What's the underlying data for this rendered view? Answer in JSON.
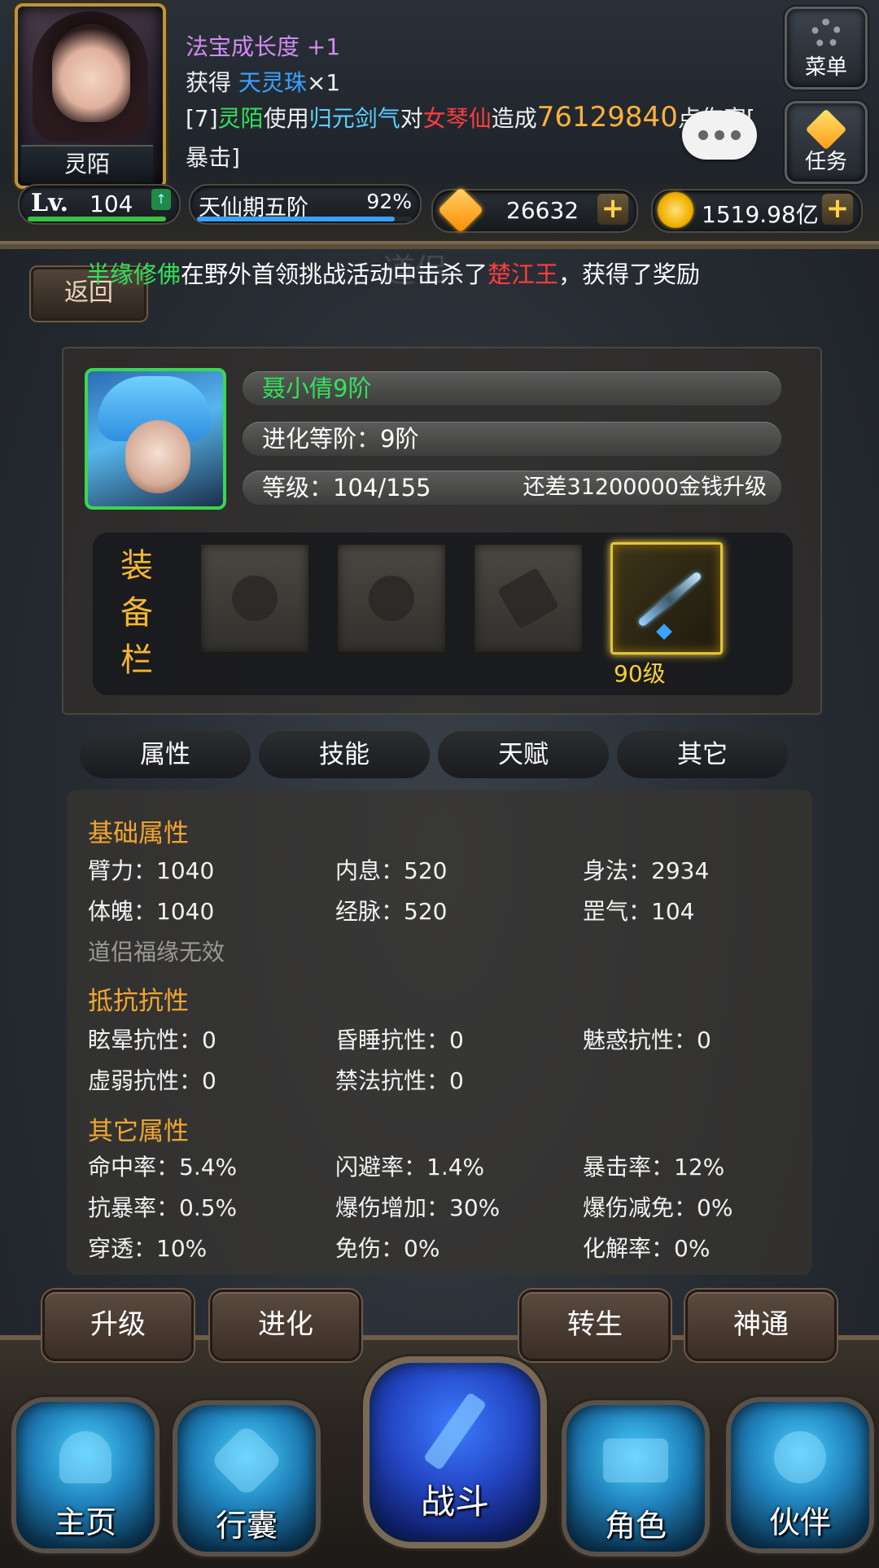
{
  "player": {
    "avatar_name": "灵陌",
    "level_prefix": "Lv.",
    "level": "104",
    "realm": "天仙期五阶",
    "realm_progress": "92%",
    "realm_progress_value": 0.92,
    "diamonds": "26632",
    "gold": "1519.98亿"
  },
  "messages": {
    "line1_label": "法宝成长度",
    "line1_value": "+1",
    "line2_prefix": "获得",
    "line2_item": "天灵珠",
    "line2_count": "×1",
    "line3_tag": "[7]",
    "line3_actor": "灵陌",
    "line3_use": "使用",
    "line3_skill": "归元剑气",
    "line3_to": "对",
    "line3_target": "女琴仙",
    "line3_cause": "造成",
    "line3_damage": "76129840",
    "line3_tail": "点伤害[",
    "line4": "暴击]"
  },
  "side_buttons": {
    "menu": "菜单",
    "task": "任务"
  },
  "broadcast": {
    "player": "半缘修佛",
    "text1": "在野外首领挑战活动中击杀了",
    "boss": "楚江王",
    "text2": "，获得了奖励"
  },
  "nav_top": {
    "back": "返回",
    "faded_title": "道侣"
  },
  "partner": {
    "name": "聂小倩9阶",
    "evolve": "进化等阶：9阶",
    "level": "等级：104/155",
    "upgrade_hint": "还差31200000金钱升级"
  },
  "equipment": {
    "label_chars": [
      "装",
      "备",
      "栏"
    ],
    "weapon_level": "90级"
  },
  "tabs": [
    "属性",
    "技能",
    "天赋",
    "其它"
  ],
  "attributes": {
    "basic_title": "基础属性",
    "basic": [
      "臂力：1040",
      "内息：520",
      "身法：2934",
      "体魄：1040",
      "经脉：520",
      "罡气：104"
    ],
    "basic_note": "道侣福缘无效",
    "resist_title": "抵抗抗性",
    "resist": [
      "眩晕抗性：0",
      "昏睡抗性：0",
      "魅惑抗性：0",
      "虚弱抗性：0",
      "禁法抗性：0"
    ],
    "other_title": "其它属性",
    "other": [
      "命中率：5.4%",
      "闪避率：1.4%",
      "暴击率：12%",
      "抗暴率：0.5%",
      "爆伤增加：30%",
      "爆伤减免：0%",
      "穿透：10%",
      "免伤：0%",
      "化解率：0%"
    ]
  },
  "actions": [
    "升级",
    "进化",
    "转生",
    "神通"
  ],
  "bottom_nav": [
    "主页",
    "行囊",
    "战斗",
    "角色",
    "伙伴"
  ]
}
